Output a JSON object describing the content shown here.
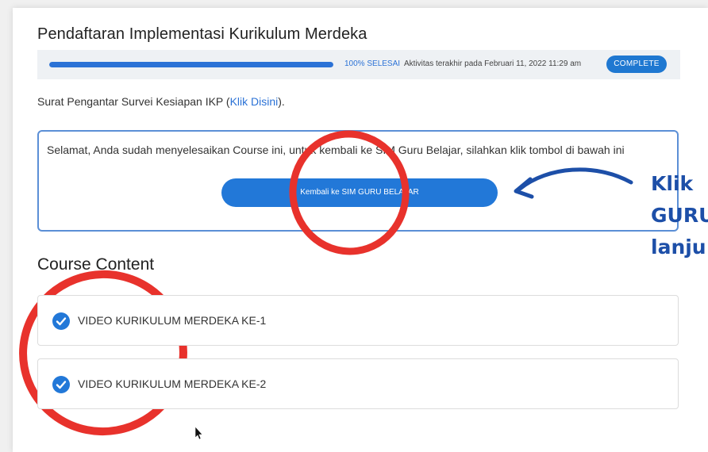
{
  "header": {
    "title": "Pendaftaran Implementasi Kurikulum Merdeka"
  },
  "progress": {
    "percent": 100,
    "label": "100% SELESAI",
    "activity": "Aktivitas terakhir pada Februari 11, 2022 11:29 am",
    "badge": "COMPLETE"
  },
  "survey": {
    "prefix": "Surat Pengantar Survei Kesiapan IKP (",
    "link": "Klik Disini",
    "suffix": ")."
  },
  "notice": {
    "message": "Selamat, Anda sudah menyelesaikan Course ini, untuk kembali ke SIM Guru Belajar, silahkan klik tombol di bawah ini",
    "button_label": "Kembali ke SIM GURU BELAJAR"
  },
  "callout": {
    "line1": "Klik",
    "line2": "GURU",
    "line3": "lanju"
  },
  "course": {
    "section_title": "Course Content",
    "items": [
      {
        "label": "VIDEO KURIKULUM MERDEKA KE-1",
        "completed": true
      },
      {
        "label": "VIDEO KURIKULUM MERDEKA KE-2",
        "completed": true
      }
    ]
  },
  "colors": {
    "accent": "#2278d8",
    "annotation_red": "#e8322c",
    "callout_blue": "#1d4fa8"
  }
}
